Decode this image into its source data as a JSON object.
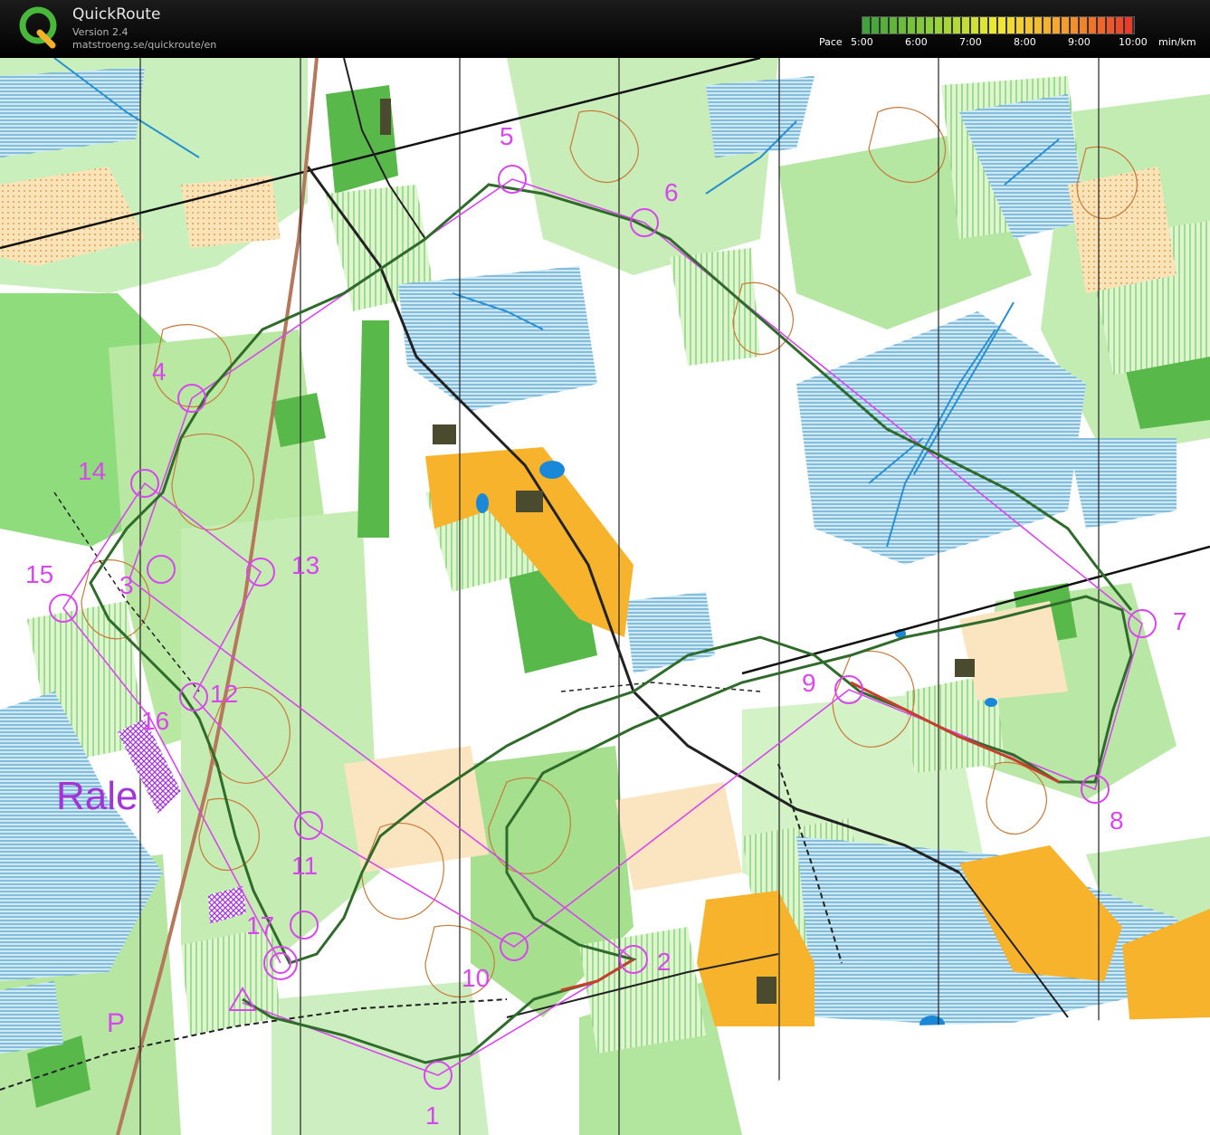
{
  "header": {
    "title": "QuickRoute",
    "version": "Version 2.4",
    "url": "matstroeng.se/quickroute/en",
    "logo_letter": "Q"
  },
  "pace_legend": {
    "label": "Pace",
    "ticks": [
      "5:00",
      "6:00",
      "7:00",
      "8:00",
      "9:00",
      "10:00"
    ],
    "unit": "min/km",
    "colors": [
      "#3da33a",
      "#8fd13a",
      "#f2ea2f",
      "#f5a02a",
      "#ec3b2a"
    ]
  },
  "map": {
    "area_label": "Rale",
    "parking_label": "P",
    "controls": [
      {
        "number": "1"
      },
      {
        "number": "2"
      },
      {
        "number": "3"
      },
      {
        "number": "4"
      },
      {
        "number": "5"
      },
      {
        "number": "6"
      },
      {
        "number": "7"
      },
      {
        "number": "8"
      },
      {
        "number": "9"
      },
      {
        "number": "10"
      },
      {
        "number": "11"
      },
      {
        "number": "12"
      },
      {
        "number": "13"
      },
      {
        "number": "14"
      },
      {
        "number": "15"
      },
      {
        "number": "16"
      },
      {
        "number": "17"
      }
    ],
    "course_color": "#d946ef",
    "route_color": "#2f6b2a"
  }
}
